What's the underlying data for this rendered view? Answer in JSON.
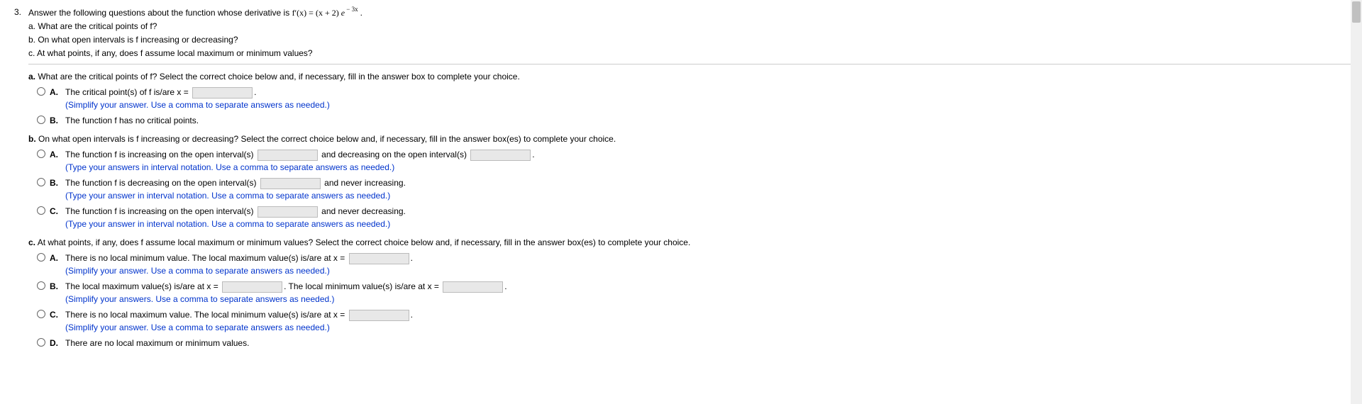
{
  "question_number": "3.",
  "stem": {
    "intro": "Answer the following questions about the function whose derivative is ",
    "formula_prefix": "f′(x) = (x + 2) ",
    "formula_e": "e",
    "formula_exp": " − 3x",
    "period": ".",
    "a": "a. What are the critical points of f?",
    "b": "b. On what open intervals is f increasing or decreasing?",
    "c": "c. At what points, if any, does f assume local maximum or minimum values?"
  },
  "part_a": {
    "prompt_pre": "a.",
    "prompt": " What are the critical points of f? Select the correct choice below and, if necessary, fill in the answer box to complete your choice.",
    "choices": {
      "A": {
        "text_pre": "The critical point(s) of f is/are x = ",
        "text_post": ".",
        "hint": "(Simplify your answer. Use a comma to separate answers as needed.)"
      },
      "B": {
        "text": "The function f has no critical points."
      }
    }
  },
  "part_b": {
    "prompt_pre": "b.",
    "prompt": " On what open intervals is f increasing or decreasing? Select the correct choice below and, if necessary, fill in the answer box(es) to complete your choice.",
    "choices": {
      "A": {
        "t1": "The function f is increasing on the open interval(s) ",
        "t2": " and decreasing on the open interval(s) ",
        "t3": ".",
        "hint": "(Type your answers in interval notation. Use a comma to separate answers as needed.)"
      },
      "B": {
        "t1": "The function f is decreasing on the open interval(s) ",
        "t2": " and never increasing.",
        "hint": "(Type your answer in interval notation. Use a comma to separate answers as needed.)"
      },
      "C": {
        "t1": "The function f is increasing on the open interval(s) ",
        "t2": " and never decreasing.",
        "hint": "(Type your answer in interval notation. Use a comma to separate answers as needed.)"
      }
    }
  },
  "part_c": {
    "prompt_pre": "c.",
    "prompt": " At what points, if any, does f assume local maximum or minimum values? Select the correct choice below and, if necessary, fill in the answer box(es) to complete your choice.",
    "choices": {
      "A": {
        "t1": "There is no local minimum value. The local maximum value(s) is/are at x = ",
        "t2": ".",
        "hint": "(Simplify your answer. Use a comma to separate answers as needed.)"
      },
      "B": {
        "t1": "The local maximum value(s) is/are at x = ",
        "t2": ". The local minimum value(s) is/are at x = ",
        "t3": ".",
        "hint": "(Simplify your answers. Use a comma to separate answers as needed.)"
      },
      "C": {
        "t1": "There is no local maximum value. The local minimum value(s) is/are at x = ",
        "t2": ".",
        "hint": "(Simplify your answer. Use a comma to separate answers as needed.)"
      },
      "D": {
        "text": "There are no local maximum or minimum values."
      }
    }
  },
  "labels": {
    "A": "A.",
    "B": "B.",
    "C": "C.",
    "D": "D."
  }
}
